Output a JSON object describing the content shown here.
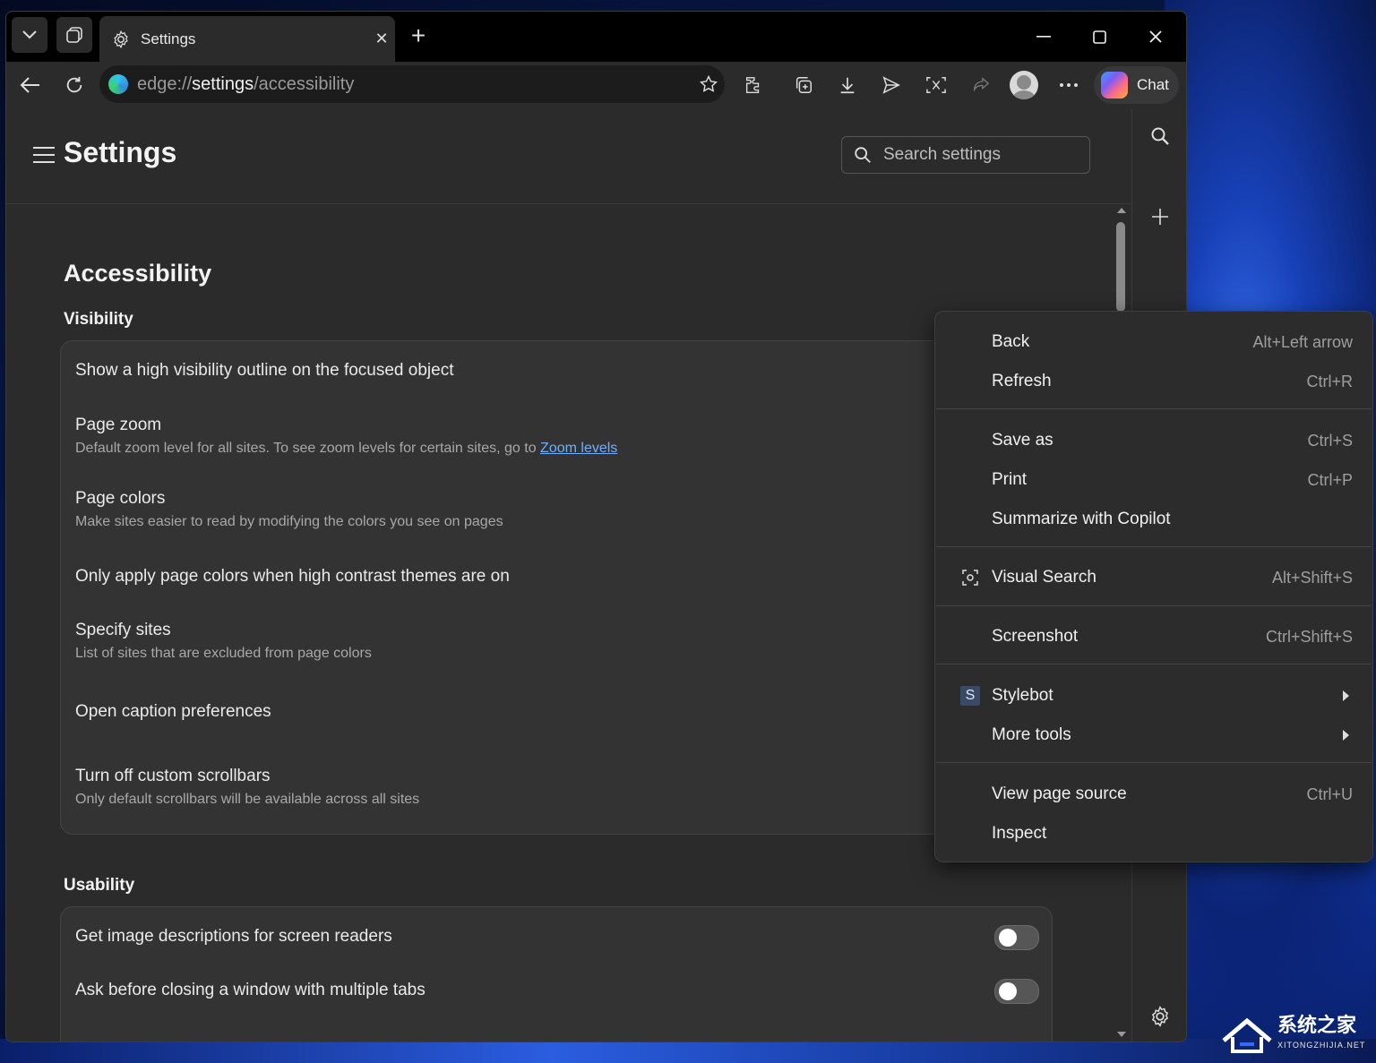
{
  "browser": {
    "tab_title": "Settings",
    "url_scheme": "edge://",
    "url_host": "settings",
    "url_path": "/accessibility",
    "chat_label": "Chat"
  },
  "settings": {
    "title": "Settings",
    "search_placeholder": "Search settings",
    "page_heading": "Accessibility",
    "visibility_heading": "Visibility",
    "visibility_items": [
      {
        "title": "Show a high visibility outline on the focused object",
        "desc": ""
      },
      {
        "title": "Page zoom",
        "desc": "Default zoom level for all sites. To see zoom levels for certain sites, go to ",
        "link": "Zoom levels"
      },
      {
        "title": "Page colors",
        "desc": "Make sites easier to read by modifying the colors you see on pages"
      },
      {
        "title": "Only apply page colors when high contrast themes are on",
        "desc": ""
      },
      {
        "title": "Specify sites",
        "desc": "List of sites that are excluded from page colors"
      },
      {
        "title": "Open caption preferences",
        "desc": ""
      },
      {
        "title": "Turn off custom scrollbars",
        "desc": "Only default scrollbars will be available across all sites"
      }
    ],
    "usability_heading": "Usability",
    "usability_items": [
      {
        "title": "Get image descriptions for screen readers",
        "toggle_on": false
      },
      {
        "title": "Ask before closing a window with multiple tabs",
        "toggle_on": false
      }
    ]
  },
  "context_menu": {
    "items": [
      {
        "label": "Back",
        "shortcut": "Alt+Left arrow"
      },
      {
        "label": "Refresh",
        "shortcut": "Ctrl+R"
      },
      {
        "label": "Save as",
        "shortcut": "Ctrl+S"
      },
      {
        "label": "Print",
        "shortcut": "Ctrl+P"
      },
      {
        "label": "Summarize with Copilot",
        "shortcut": ""
      },
      {
        "label": "Visual Search",
        "shortcut": "Alt+Shift+S",
        "icon": "visual-search-icon"
      },
      {
        "label": "Screenshot",
        "shortcut": "Ctrl+Shift+S"
      },
      {
        "label": "Stylebot",
        "shortcut": "",
        "icon": "stylebot-icon",
        "badge": "S"
      },
      {
        "label": "More tools",
        "shortcut": ""
      },
      {
        "label": "View page source",
        "shortcut": "Ctrl+U"
      },
      {
        "label": "Inspect",
        "shortcut": ""
      }
    ]
  },
  "watermark": {
    "text": "系统之家",
    "sub": "XITONGZHIJIA.NET"
  },
  "colors": {
    "accent": "#6cb0ff",
    "window_bg": "#2b2b2b",
    "menu_bg": "#2c2c2c"
  }
}
